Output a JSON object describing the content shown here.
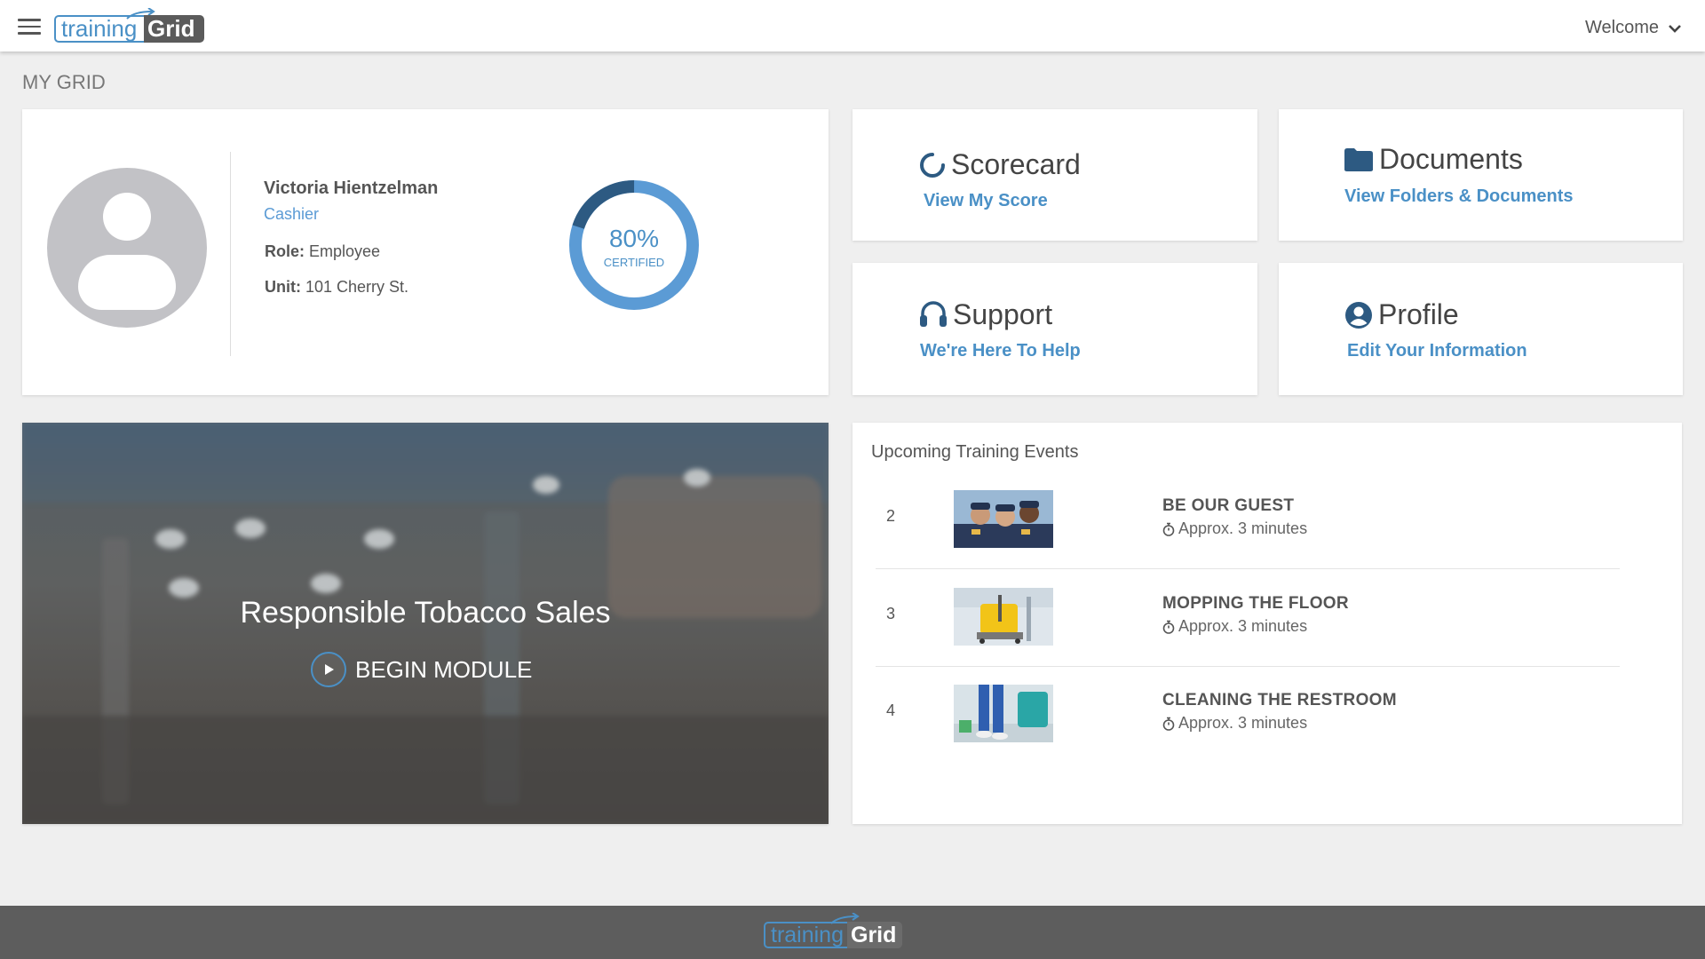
{
  "header": {
    "logo_part1": "training",
    "logo_part2": "Grid",
    "welcome_label": "Welcome"
  },
  "page": {
    "title": "MY GRID"
  },
  "profile": {
    "name": "Victoria Hientzelman",
    "job_title": "Cashier",
    "role_label": "Role:",
    "role_value": "Employee",
    "unit_label": "Unit:",
    "unit_value": "101 Cherry St.",
    "certified_percent": 80,
    "certified_percent_text": "80%",
    "certified_label": "CERTIFIED"
  },
  "tiles": {
    "scorecard": {
      "title": "Scorecard",
      "link": "View My Score",
      "icon": "circle-notch-icon"
    },
    "documents": {
      "title": "Documents",
      "link": "View Folders & Documents",
      "icon": "folder-icon"
    },
    "support": {
      "title": "Support",
      "link": "We're Here To Help",
      "icon": "headset-icon"
    },
    "profile": {
      "title": "Profile",
      "link": "Edit Your Information",
      "icon": "user-circle-icon"
    }
  },
  "module": {
    "title": "Responsible Tobacco Sales",
    "begin_label": "BEGIN MODULE"
  },
  "events": {
    "title": "Upcoming Training Events",
    "items": [
      {
        "number": "2",
        "name": "BE OUR GUEST",
        "duration": "Approx. 3 minutes"
      },
      {
        "number": "3",
        "name": "MOPPING THE FLOOR",
        "duration": "Approx. 3 minutes"
      },
      {
        "number": "4",
        "name": "CLEANING THE RESTROOM",
        "duration": "Approx. 3 minutes"
      }
    ]
  },
  "footer": {
    "logo_part1": "training",
    "logo_part2": "Grid"
  },
  "colors": {
    "accent": "#4a90c6",
    "dark_accent": "#2d5a82",
    "footer_bg": "#5d5d5d",
    "page_bg": "#efefef"
  }
}
